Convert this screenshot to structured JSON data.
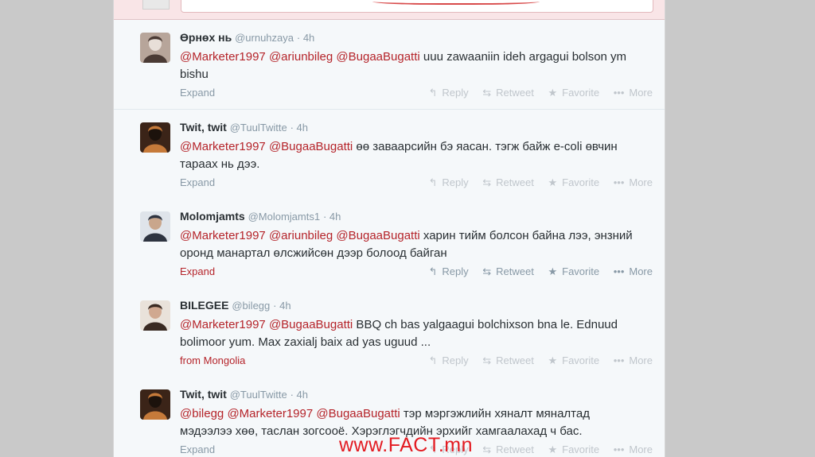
{
  "tweets": [
    {
      "name": "Өрнөх нь",
      "handle": "@urnuhzaya",
      "time": "4h",
      "parts": [
        {
          "t": "@Marketer1997",
          "m": true
        },
        {
          "t": " ",
          "m": false
        },
        {
          "t": "@ariunbileg",
          "m": true
        },
        {
          "t": " ",
          "m": false
        },
        {
          "t": "@BugaaBugatti",
          "m": true
        },
        {
          "t": "  uuu zawaaniin ideh argagui bolson ym bishu",
          "m": false
        }
      ],
      "footer": "Expand",
      "footer_red": false,
      "actions_dark": false,
      "avatar": [
        "#b7a59a",
        "#4a3a34",
        "#e8dfd8"
      ]
    },
    {
      "name": "Twit, twit",
      "handle": "@TuulTwitte",
      "time": "4h",
      "parts": [
        {
          "t": "@Marketer1997",
          "m": true
        },
        {
          "t": " ",
          "m": false
        },
        {
          "t": "@BugaaBugatti",
          "m": true
        },
        {
          "t": " өө заваарсийн бэ яасан. тэгж байж e-coli өвчин тараах нь дээ.",
          "m": false
        }
      ],
      "footer": "Expand",
      "footer_red": false,
      "actions_dark": false,
      "avatar": [
        "#3b2418",
        "#c67a3a",
        "#1c120c"
      ]
    },
    {
      "name": "Molomjamts",
      "handle": "@Molomjamts1",
      "time": "4h",
      "parts": [
        {
          "t": "@Marketer1997",
          "m": true
        },
        {
          "t": " ",
          "m": false
        },
        {
          "t": "@ariunbileg",
          "m": true
        },
        {
          "t": " ",
          "m": false
        },
        {
          "t": "@BugaaBugatti",
          "m": true
        },
        {
          "t": " харин тийм болсон байна лээ, энзний оронд манартал өлсжийсөн дээр болоод байган",
          "m": false
        }
      ],
      "footer": "Expand",
      "footer_red": true,
      "actions_dark": true,
      "avatar": [
        "#dfe4ea",
        "#2e3440",
        "#c9a68c"
      ]
    },
    {
      "name": "BILEGEE",
      "handle": "@bilegg",
      "time": "4h",
      "parts": [
        {
          "t": "@Marketer1997",
          "m": true
        },
        {
          "t": " ",
          "m": false
        },
        {
          "t": "@BugaaBugatti",
          "m": true
        },
        {
          "t": " BBQ ch bas yalgaagui bolchixson bna le. Ednuud bolimoor yum. Max zaxialj baix ad yas uguud ...",
          "m": false
        }
      ],
      "footer": "from Mongolia",
      "footer_red": true,
      "actions_dark": false,
      "avatar": [
        "#e9e2da",
        "#3a2a22",
        "#d0a890"
      ]
    },
    {
      "name": "Twit, twit",
      "handle": "@TuulTwitte",
      "time": "4h",
      "parts": [
        {
          "t": "@bilegg",
          "m": true
        },
        {
          "t": " ",
          "m": false
        },
        {
          "t": "@Marketer1997",
          "m": true
        },
        {
          "t": " ",
          "m": false
        },
        {
          "t": "@BugaaBugatti",
          "m": true
        },
        {
          "t": " тэр мэргэжлийн хяналт мяналтад мэдээлээ хөө, таслан зогсооё.  Хэрэглэгчдийн эрхийг хамгаалахад ч бас.",
          "m": false
        }
      ],
      "footer": "Expand",
      "footer_red": false,
      "actions_dark": false,
      "avatar": [
        "#3b2418",
        "#c67a3a",
        "#1c120c"
      ]
    }
  ],
  "actions": {
    "reply": "Reply",
    "retweet": "Retweet",
    "favorite": "Favorite",
    "more": "More"
  },
  "icons": {
    "reply": "reply-arrow-icon",
    "retweet": "retweet-icon",
    "favorite": "star-icon",
    "more": "more-dots-icon"
  },
  "colors": {
    "mention": "#b5242a",
    "background": "#f5f8fa",
    "meta": "#8899a6",
    "watermark": "#e31b22"
  },
  "watermark": "www.FACT.mn"
}
